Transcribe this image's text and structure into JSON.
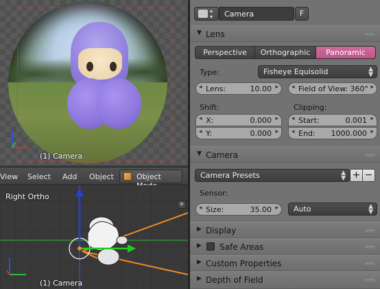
{
  "camera_view": {
    "label": "(1) Camera",
    "frame_color": "#d03a3a"
  },
  "view_header": {
    "menus": [
      "View",
      "Select",
      "Add",
      "Object"
    ],
    "mode": "Object Mode",
    "mode_icon": "cube-icon"
  },
  "ortho_view": {
    "view_label": "Right Ortho",
    "object_label": "(1) Camera",
    "axis_colors": {
      "x": "#2fbf2f",
      "y": "#e02a2a",
      "z": "#2a4fe0"
    },
    "camera_line_color": "#f08a24"
  },
  "properties": {
    "header": {
      "datablock_name": "Camera",
      "fake_user": "F",
      "icon": "camera-data-icon"
    },
    "lens_panel": {
      "title": "Lens",
      "tabs": [
        "Perspective",
        "Orthographic",
        "Panoramic"
      ],
      "active_tab": "Panoramic",
      "type_label": "Type:",
      "type_value": "Fisheye Equisolid",
      "lens_label": "Lens:",
      "lens_value": "10.00",
      "fov_label": "Field of View:",
      "fov_value": "360°",
      "shift_label": "Shift:",
      "shift_x_label": "X:",
      "shift_x_value": "0.000",
      "shift_y_label": "Y:",
      "shift_y_value": "0.000",
      "clipping_label": "Clipping:",
      "clip_start_label": "Start:",
      "clip_start_value": "0.001",
      "clip_end_label": "End:",
      "clip_end_value": "1000.000"
    },
    "camera_panel": {
      "title": "Camera",
      "presets_value": "Camera Presets",
      "add_label": "+",
      "remove_label": "−",
      "sensor_label": "Sensor:",
      "size_label": "Size:",
      "size_value": "35.00",
      "fit_value": "Auto"
    },
    "collapsed_panels": {
      "display": "Display",
      "safe_areas": "Safe Areas",
      "custom_properties": "Custom Properties",
      "depth_of_field": "Depth of Field"
    },
    "accent_color": "#c65a90"
  }
}
